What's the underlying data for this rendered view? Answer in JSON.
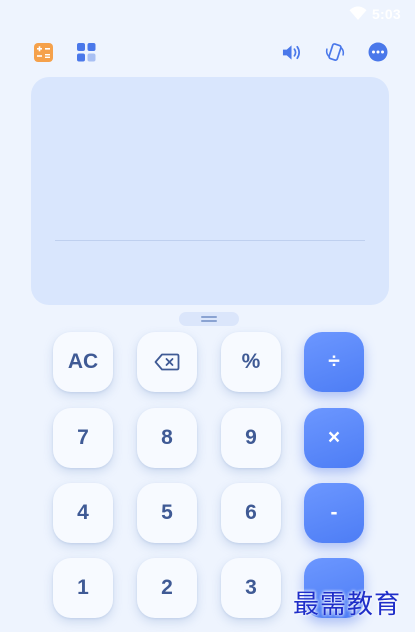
{
  "status_bar": {
    "time": "5:03"
  },
  "toolbar": {
    "left": [
      "calculator-mode-icon",
      "grid-apps-icon"
    ],
    "right": [
      "speaker-icon",
      "phone-rotate-icon",
      "more-icon"
    ]
  },
  "display": {
    "expression": "",
    "result": ""
  },
  "keypad": {
    "row1": [
      "AC",
      "⌫",
      "%",
      "÷"
    ],
    "row2": [
      "7",
      "8",
      "9",
      "×"
    ],
    "row3": [
      "4",
      "5",
      "6",
      "-"
    ],
    "row4": [
      "1",
      "2",
      "3",
      ""
    ]
  },
  "watermark": "最需教育",
  "colors": {
    "background": "#eef4fe",
    "display": "#d9e6fd",
    "key": "#f7faff",
    "operator": "#5a88fa",
    "key_text": "#3f5a95",
    "toolbar_orange": "#f5a14b",
    "toolbar_blue": "#4a78ea"
  }
}
